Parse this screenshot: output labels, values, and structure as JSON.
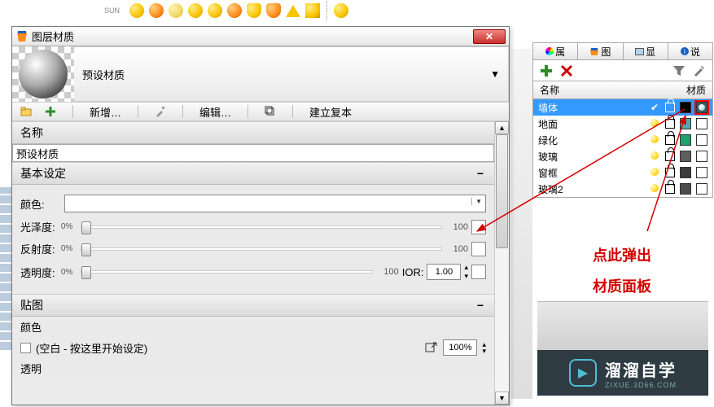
{
  "top_toolbar": {
    "sun_label": "SUN"
  },
  "dialog": {
    "title": "图层材质",
    "preset_label": "预设材质",
    "toolbar": {
      "new_label": "新增…",
      "edit_label": "编辑…",
      "copy_label": "建立复本"
    },
    "sections": {
      "name_header": "名称",
      "name_value": "预设材质",
      "basic_header": "基本设定",
      "color_label": "颜色:",
      "gloss_label": "光泽度:",
      "gloss_left": "0%",
      "gloss_right": "100",
      "reflect_label": "反射度:",
      "reflect_left": "0%",
      "reflect_right": "100",
      "transp_label": "透明度:",
      "transp_left": "0%",
      "transp_right": "100",
      "ior_label": "IOR:",
      "ior_value": "1.00",
      "map_header": "贴图",
      "map_color_label": "颜色",
      "map_empty_label": "(空白 - 按这里开始设定)",
      "map_pct": "100%",
      "map_alpha_label": "透明"
    }
  },
  "right_panel": {
    "tabs": {
      "t1": "属",
      "t2": "图",
      "t3": "显",
      "t4": "说"
    },
    "headers": {
      "name": "名称",
      "mat": "材质"
    },
    "layers": [
      {
        "name": "墙体",
        "visible_check": true,
        "color": "#000000",
        "mat_highlight": true
      },
      {
        "name": "地面",
        "visible_bulb": true,
        "color": "#54a8a8"
      },
      {
        "name": "绿化",
        "visible_bulb": true,
        "color": "#22a06b"
      },
      {
        "name": "玻璃",
        "visible_bulb": true,
        "color": "#5e5e5e"
      },
      {
        "name": "窗框",
        "visible_bulb": true,
        "color": "#3b3b3b"
      },
      {
        "name": "玻璃2",
        "visible_bulb": true,
        "color": "#4c4c4c"
      }
    ]
  },
  "annotation": {
    "line1": "点此弹出",
    "line2": "材质面板"
  },
  "footer": {
    "main": "溜溜自学",
    "sub": "ZIXUE.3D66.COM"
  }
}
